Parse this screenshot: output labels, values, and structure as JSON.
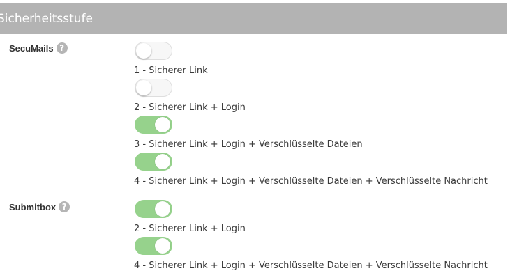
{
  "section": {
    "title": "Sicherheitsstufe"
  },
  "help_icon_glyph": "?",
  "colors": {
    "header_bg": "#b3b3b3",
    "toggle_on": "#96d28c",
    "toggle_off": "#f7f7f7"
  },
  "groups": [
    {
      "label": "SecuMails",
      "options": [
        {
          "label": "1 - Sicherer Link",
          "enabled": false
        },
        {
          "label": "2 - Sicherer Link + Login",
          "enabled": false
        },
        {
          "label": "3 - Sicherer Link + Login + Verschlüsselte Dateien",
          "enabled": true
        },
        {
          "label": "4 - Sicherer Link + Login + Verschlüsselte Dateien + Verschlüsselte Nachricht",
          "enabled": true
        }
      ]
    },
    {
      "label": "Submitbox",
      "options": [
        {
          "label": "2 - Sicherer Link + Login",
          "enabled": true
        },
        {
          "label": "4 - Sicherer Link + Login + Verschlüsselte Dateien + Verschlüsselte Nachricht",
          "enabled": true
        }
      ]
    }
  ]
}
